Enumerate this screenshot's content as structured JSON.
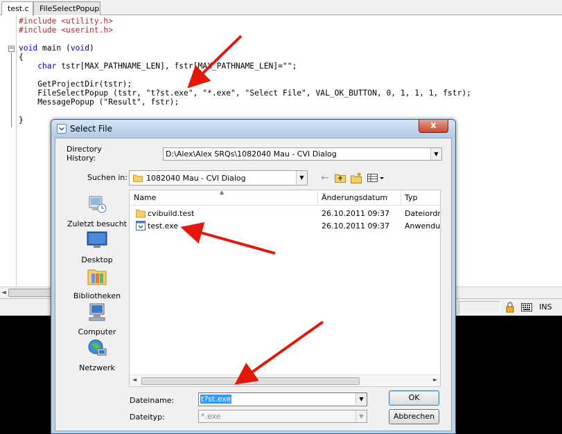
{
  "editor": {
    "tabs": [
      {
        "label": "test.c"
      },
      {
        "label": "FileSelectPopup"
      }
    ],
    "code_lines": [
      {
        "parts": [
          {
            "t": "#include ",
            "c": "prep"
          },
          {
            "t": "<utility.h>",
            "c": "prep"
          }
        ]
      },
      {
        "parts": [
          {
            "t": "#include ",
            "c": "prep"
          },
          {
            "t": "<userint.h>",
            "c": "prep"
          }
        ]
      },
      {
        "parts": [
          {
            "t": "",
            "c": ""
          }
        ]
      },
      {
        "parts": [
          {
            "t": "void",
            "c": "kw"
          },
          {
            "t": " main (",
            "c": ""
          },
          {
            "t": "void",
            "c": "kw"
          },
          {
            "t": ")",
            "c": ""
          }
        ]
      },
      {
        "parts": [
          {
            "t": "{",
            "c": ""
          }
        ]
      },
      {
        "parts": [
          {
            "t": "    ",
            "c": ""
          },
          {
            "t": "char",
            "c": "kw"
          },
          {
            "t": " tstr[MAX_PATHNAME_LEN], fstr[MAX_PATHNAME_LEN]=\"\";",
            "c": ""
          }
        ]
      },
      {
        "parts": [
          {
            "t": "",
            "c": ""
          }
        ]
      },
      {
        "parts": [
          {
            "t": "    GetProjectDir(tstr);",
            "c": ""
          }
        ]
      },
      {
        "parts": [
          {
            "t": "    FileSelectPopup (tstr, \"t?st.exe\", \"*.exe\", \"Select File\", VAL_OK_BUTTON, 0, 1, 1, 1, fstr);",
            "c": ""
          }
        ]
      },
      {
        "parts": [
          {
            "t": "    MessagePopup (\"Result\", fstr);",
            "c": ""
          }
        ]
      },
      {
        "parts": [
          {
            "t": "",
            "c": ""
          }
        ]
      },
      {
        "parts": [
          {
            "t": "}",
            "c": ""
          }
        ]
      }
    ],
    "status": {
      "ins": "INS"
    }
  },
  "dialog": {
    "title": "Select File",
    "close_glyph": "x",
    "directory_history_label": "Directory History:",
    "directory_history_value": "D:\\Alex\\Alex SRQs\\1082040 Mau - CVI Dialog",
    "look_in_label": "Suchen in:",
    "look_in_value": "1082040 Mau - CVI Dialog",
    "places": [
      {
        "label": "Zuletzt besucht",
        "icon": "recent-places-icon"
      },
      {
        "label": "Desktop",
        "icon": "desktop-icon"
      },
      {
        "label": "Bibliotheken",
        "icon": "libraries-icon"
      },
      {
        "label": "Computer",
        "icon": "computer-icon"
      },
      {
        "label": "Netzwerk",
        "icon": "network-icon"
      }
    ],
    "columns": {
      "name": "Name",
      "date": "Änderungsdatum",
      "type": "Typ"
    },
    "files": [
      {
        "name": "cvibuild.test",
        "date": "26.10.2011 09:37",
        "type": "Dateiordn",
        "icon": "folder-icon"
      },
      {
        "name": "test.exe",
        "date": "26.10.2011 09:37",
        "type": "Anwendu",
        "icon": "exe-file-icon"
      }
    ],
    "filename_label": "Dateiname:",
    "filename_value": "t?st.exe",
    "filetype_label": "Dateityp:",
    "filetype_value": "*.exe",
    "ok_label": "OK",
    "cancel_label": "Abbrechen"
  },
  "colors": {
    "annotation_arrow": "#e3170a",
    "selection": "#3399ff",
    "preprocessor": "#a52a2a",
    "keyword": "#0000c0"
  }
}
